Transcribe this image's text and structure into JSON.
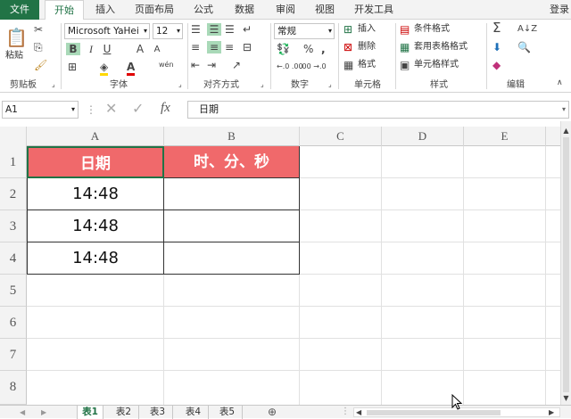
{
  "ribbon_tabs": [
    "文件",
    "开始",
    "插入",
    "页面布局",
    "公式",
    "数据",
    "审阅",
    "视图",
    "开发工具"
  ],
  "login": "登录",
  "clipboard": {
    "paste": "粘贴",
    "label": "剪贴板"
  },
  "font": {
    "name": "Microsoft YaHei",
    "size": "12",
    "bold": "B",
    "italic": "I",
    "underline": "U",
    "grow": "A",
    "shrink": "A",
    "label": "字体",
    "wen": "wén"
  },
  "alignment": {
    "label": "对齐方式"
  },
  "number": {
    "format": "常规",
    "label": "数字",
    "percent": "%",
    "comma": ",",
    "inc": "←.0 .00",
    "dec": ".00 →.0"
  },
  "cells": {
    "insert": "插入",
    "delete": "删除",
    "format": "格式",
    "label": "单元格"
  },
  "styles": {
    "conditional": "条件格式",
    "table": "套用表格格式",
    "cell": "单元格样式",
    "label": "样式"
  },
  "editing": {
    "label": "编辑"
  },
  "formula_bar": {
    "name_box": "A1",
    "fx": "fx",
    "value": "日期"
  },
  "columns": [
    "A",
    "B",
    "C",
    "D",
    "E"
  ],
  "rows": [
    "1",
    "2",
    "3",
    "4",
    "5",
    "6",
    "7",
    "8"
  ],
  "table": {
    "headers": [
      "日期",
      "时、分、秒"
    ],
    "rows": [
      [
        "14:48",
        ""
      ],
      [
        "14:48",
        ""
      ],
      [
        "14:48",
        ""
      ]
    ]
  },
  "sheets": [
    "表1",
    "表2",
    "表3",
    "表4",
    "表5"
  ],
  "colors": {
    "accent": "#217346",
    "header_fill": "#f0696b",
    "highlight": "#a9d9b8"
  }
}
